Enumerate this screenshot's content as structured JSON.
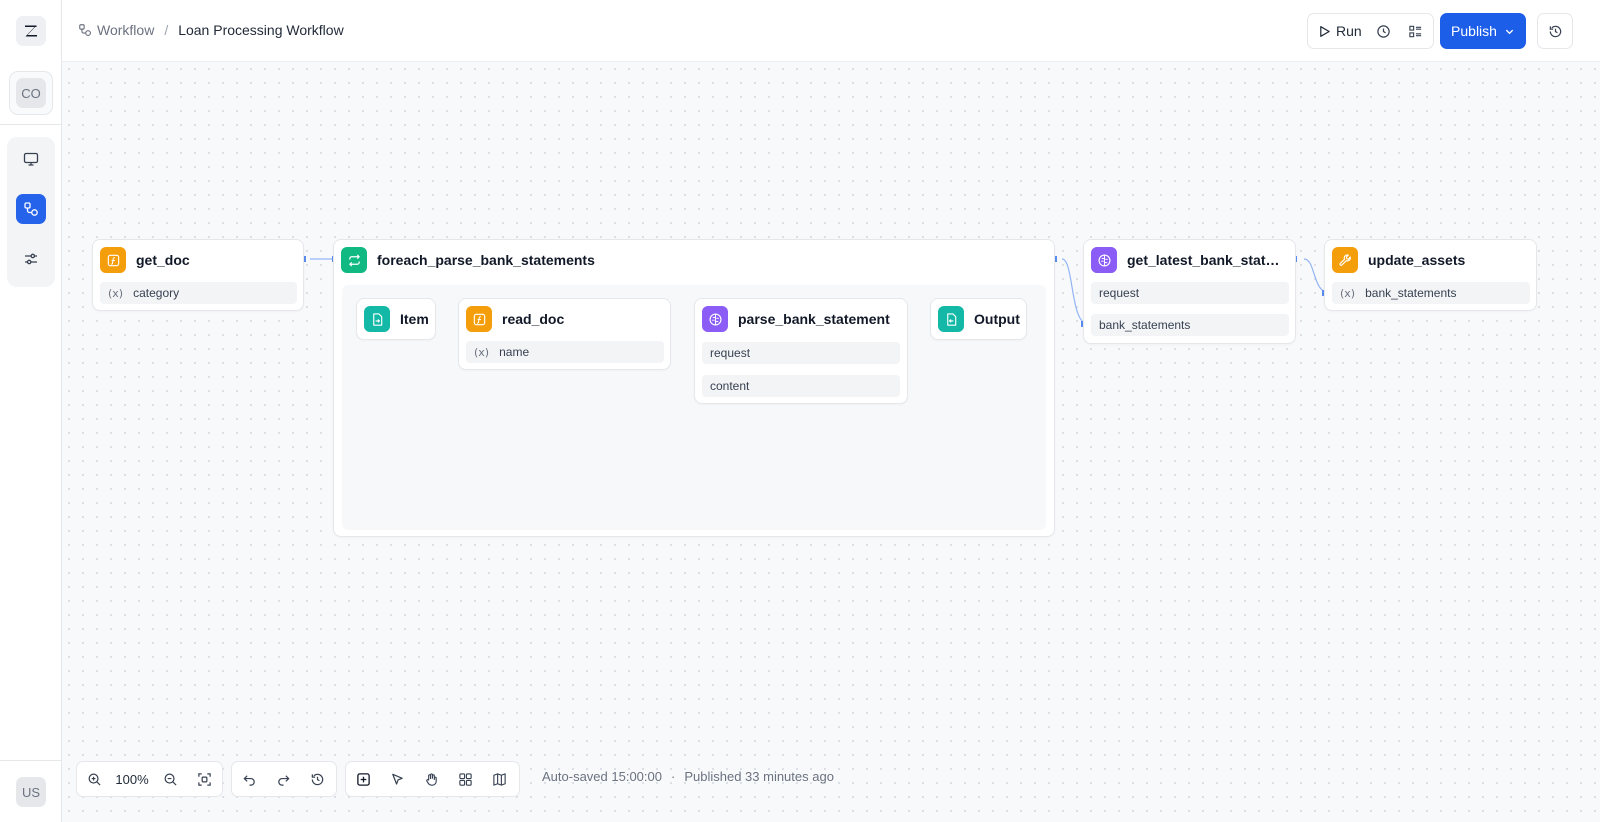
{
  "app": {
    "logo_icon": "brand-z-logo",
    "workspace_avatar": "CO",
    "user_avatar": "US",
    "accent": "#1d5ee8"
  },
  "sidebar": {
    "items": [
      {
        "name": "monitor",
        "icon": "monitor-icon",
        "active": false
      },
      {
        "name": "workflows",
        "icon": "workflow-icon",
        "active": true
      },
      {
        "name": "settings",
        "icon": "sliders-icon",
        "active": false
      }
    ]
  },
  "header": {
    "breadcrumb_root": "Workflow",
    "breadcrumb_sep": "/",
    "breadcrumb_current": "Loan Processing Workflow",
    "run_label": "Run",
    "publish_label": "Publish"
  },
  "nodes": {
    "get_doc": {
      "title": "get_doc",
      "icon": "function-icon",
      "params": [
        "category"
      ]
    },
    "foreach": {
      "title": "foreach_parse_bank_statements",
      "icon": "loop-icon"
    },
    "item": {
      "title": "Item",
      "icon": "file-input-icon"
    },
    "read_doc": {
      "title": "read_doc",
      "icon": "function-icon",
      "params": [
        "name"
      ]
    },
    "parse_bank_statement": {
      "title": "parse_bank_statement",
      "icon": "brain-icon",
      "params": [
        "request",
        "content"
      ]
    },
    "output": {
      "title": "Output",
      "icon": "file-output-icon"
    },
    "get_latest": {
      "title": "get_latest_bank_statements",
      "icon": "brain-icon",
      "params": [
        "request",
        "bank_statements"
      ]
    },
    "update_assets": {
      "title": "update_assets",
      "icon": "wrench-icon",
      "params": [
        "bank_statements"
      ]
    }
  },
  "param_icon_glyph": "(x)",
  "footer": {
    "zoom": "100%",
    "autosaved": "Auto-saved 15:00:00",
    "separator": "·",
    "published": "Published 33 minutes ago"
  },
  "colors": {
    "function": "#f59e0b",
    "loop": "#10b981",
    "io": "#14b8a6",
    "llm": "#8b5cf6",
    "edge": "#93b4f5"
  }
}
